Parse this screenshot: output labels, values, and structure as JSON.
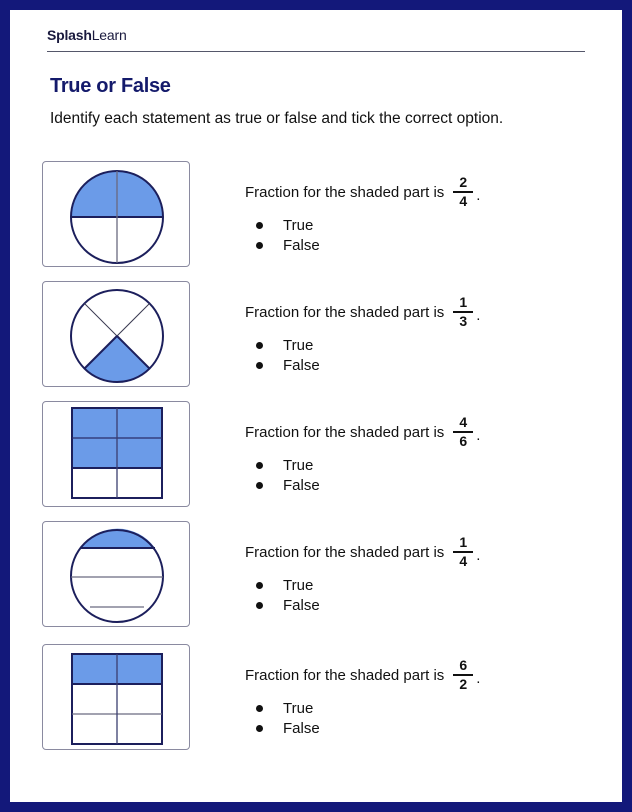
{
  "brand": {
    "bold": "Splash",
    "regular": "Learn"
  },
  "title": "True or False",
  "instructions": "Identify each statement as true or false and tick the correct option.",
  "colors": {
    "border": "#13187a",
    "title": "#141a6b",
    "shade": "#6b9be8",
    "outline": "#1c1f5c"
  },
  "questions": [
    {
      "figure": "circle-halves-top-shaded",
      "shape": "circle",
      "shaded_description": "top half of circle divided into 4 parts shaded",
      "statement": "Fraction for the shaded part is",
      "numerator": "2",
      "denominator": "4",
      "period": ".",
      "options": [
        "True",
        "False"
      ]
    },
    {
      "figure": "circle-quarters-x-bottom-shaded",
      "shape": "circle",
      "shaded_description": "bottom quarter of circle divided diagonally into 4 parts shaded",
      "statement": "Fraction for the shaded part is",
      "numerator": "1",
      "denominator": "3",
      "period": ".",
      "options": [
        "True",
        "False"
      ]
    },
    {
      "figure": "rectangle-2x3-four-shaded",
      "shape": "rectangle",
      "shaded_description": "4 of 6 cells shaded",
      "statement": "Fraction for the shaded part is",
      "numerator": "4",
      "denominator": "6",
      "period": ".",
      "options": [
        "True",
        "False"
      ]
    },
    {
      "figure": "circle-unequal-strips-top-shaded",
      "shape": "circle",
      "shaded_description": "top strip of circle divided into 4 unequal horizontal strips shaded",
      "statement": "Fraction for the shaded part is",
      "numerator": "1",
      "denominator": "4",
      "period": ".",
      "options": [
        "True",
        "False"
      ]
    },
    {
      "figure": "rectangle-2x3-two-shaded",
      "shape": "rectangle",
      "shaded_description": "2 of 6 cells shaded (top row)",
      "statement": "Fraction for the shaded part is",
      "numerator": "6",
      "denominator": "2",
      "period": ".",
      "options": [
        "True",
        "False"
      ]
    }
  ]
}
